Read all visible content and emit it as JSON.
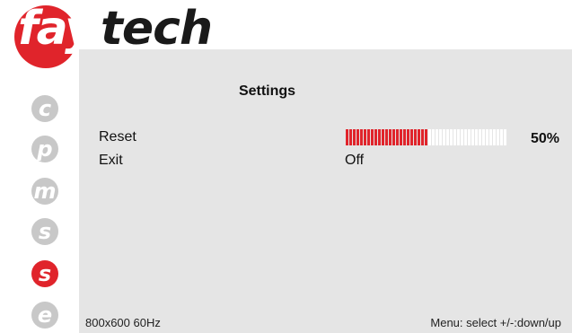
{
  "brand": {
    "prefix": "fay",
    "suffix": "tech"
  },
  "menu": {
    "title": "Settings",
    "items": [
      {
        "label": "Reset",
        "value_text": "50%",
        "progress": 0.5
      },
      {
        "label": "Exit",
        "value_text": "Off"
      }
    ]
  },
  "side_nav": [
    {
      "letter": "c",
      "active": false
    },
    {
      "letter": "p",
      "active": false
    },
    {
      "letter": "m",
      "active": false
    },
    {
      "letter": "s",
      "active": false
    },
    {
      "letter": "s",
      "active": true
    },
    {
      "letter": "e",
      "active": false
    }
  ],
  "status": {
    "resolution": "800x600 60Hz",
    "hint": "Menu: select +/-:down/up"
  },
  "colors": {
    "accent": "#e0242b",
    "inactive": "#c8c8c8",
    "bar_empty": "#ffffff"
  }
}
